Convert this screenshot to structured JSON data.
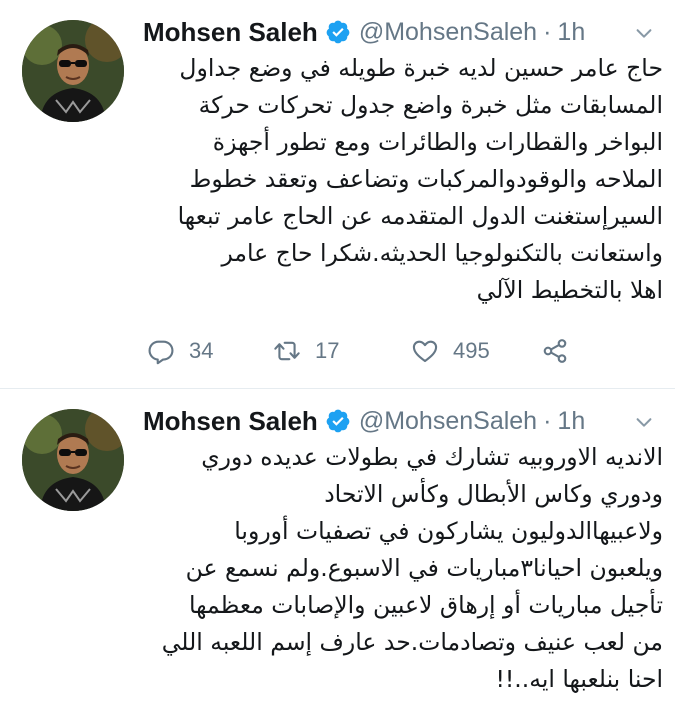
{
  "tweets": [
    {
      "author_name": "Mohsen Saleh",
      "handle": "@MohsenSaleh",
      "separator": "·",
      "time": "1h",
      "lines": [
        "حاج عامر حسين لديه خبرة طويله في وضع جداول",
        "المسابقات مثل خبرة واضع جدول تحركات حركة",
        "البواخر والقطارات والطائرات ومع تطور أجهزة",
        "الملاحه والوقودوالمركبات وتضاعف وتعقد خطوط",
        "السيرإستغنت الدول المتقدمه عن الحاج عامر تبعها",
        "واستعانت بالتكنولوجيا الحديثه.شكرا حاج عامر",
        "اهلا بالتخطيط الآلي"
      ],
      "replies": "34",
      "retweets": "17",
      "likes": "495"
    },
    {
      "author_name": "Mohsen Saleh",
      "handle": "@MohsenSaleh",
      "separator": "·",
      "time": "1h",
      "lines": [
        "الانديه الاوروبيه تشارك في بطولات عديده دوري",
        "ودوري وكاس الأبطال وكأس الاتحاد",
        "ولاعبيهاالدوليون يشاركون في تصفيات أوروبا",
        "ويلعبون احيانا٣مباريات في الاسبوع.ولم نسمع عن",
        "تأجيل مباريات أو إرهاق لاعبين والإصابات معظمها",
        "من لعب عنيف وتصادمات.حد عارف إسم اللعبه اللي",
        "احنا بنلعبها ايه..!!"
      ]
    }
  ],
  "icons": {
    "verified": "verified-badge-icon",
    "chevron": "chevron-down-icon",
    "reply": "reply-icon",
    "retweet": "retweet-icon",
    "like": "heart-icon",
    "share": "share-icon"
  },
  "colors": {
    "accent": "#1da1f2",
    "secondary_text": "#657786",
    "primary_text": "#14171a",
    "divider": "#e6ecf0"
  }
}
